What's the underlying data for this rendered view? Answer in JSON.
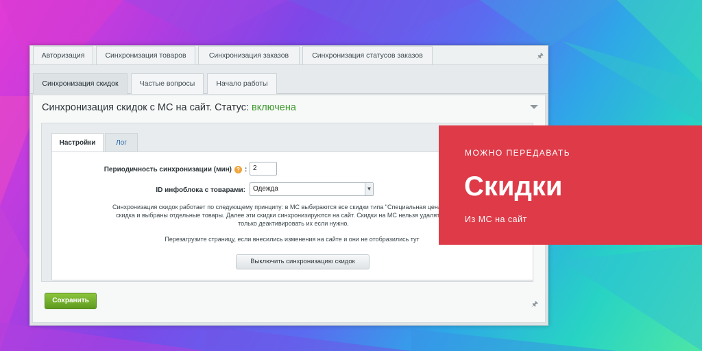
{
  "colors": {
    "banner_bg": "#de3a48",
    "status_on": "#3c9a2c",
    "save_button": "#72b12b",
    "link": "#2466a8"
  },
  "top_tabs": [
    {
      "label": "Авторизация"
    },
    {
      "label": "Синхронизация товаров"
    },
    {
      "label": "Синхронизация заказов"
    },
    {
      "label": "Синхронизация статусов заказов"
    }
  ],
  "second_tabs": [
    {
      "label": "Синхронизация скидок",
      "active": true
    },
    {
      "label": "Частые вопросы"
    },
    {
      "label": "Начало работы"
    }
  ],
  "status": {
    "title": "Синхронизация скидок с МС на сайт. Статус:",
    "value": "включена"
  },
  "inner_tabs": [
    {
      "label": "Настройки",
      "active": true
    },
    {
      "label": "Лог"
    }
  ],
  "form": {
    "period_label": "Периодичность синхронизации (мин)",
    "period_help": "?",
    "period_value": "2",
    "iblock_label": "ID инфоблока с товарами:",
    "iblock_value": "Одежда",
    "description_lines": [
      "Синхронизация скидок работает по следующему принципу: в МС выбираются все скидки типа \"Специальная цена\", у которой",
      "скидка и выбраны отдельные товары. Далее эти скидки синхронизируются на сайт. Скидки на МС нельзя удалять, так как н",
      "только деактивировать их если нужно."
    ],
    "reload_note": "Перезагрузите страницу, если внесились изменения на сайте и они не отобразились тут",
    "disable_button": "Выключить синхронизацию скидок"
  },
  "save_button": "Сохранить",
  "banner": {
    "kicker": "МОЖНО ПЕРЕДАВАТЬ",
    "title": "Скидки",
    "subtitle": "Из МС на сайт"
  }
}
